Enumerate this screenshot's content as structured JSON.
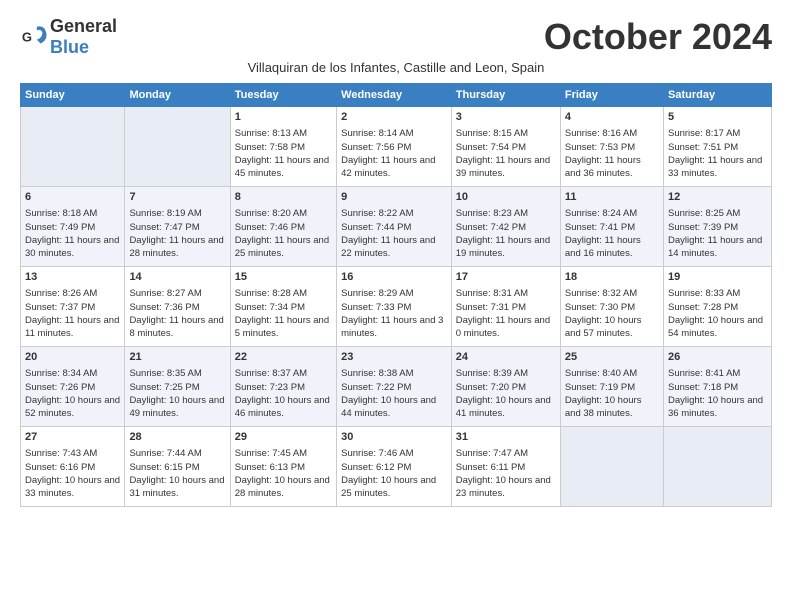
{
  "logo": {
    "text_general": "General",
    "text_blue": "Blue"
  },
  "header": {
    "month_title": "October 2024",
    "subtitle": "Villaquiran de los Infantes, Castille and Leon, Spain"
  },
  "days_of_week": [
    "Sunday",
    "Monday",
    "Tuesday",
    "Wednesday",
    "Thursday",
    "Friday",
    "Saturday"
  ],
  "weeks": [
    [
      {
        "day": "",
        "info": ""
      },
      {
        "day": "",
        "info": ""
      },
      {
        "day": "1",
        "info": "Sunrise: 8:13 AM\nSunset: 7:58 PM\nDaylight: 11 hours and 45 minutes."
      },
      {
        "day": "2",
        "info": "Sunrise: 8:14 AM\nSunset: 7:56 PM\nDaylight: 11 hours and 42 minutes."
      },
      {
        "day": "3",
        "info": "Sunrise: 8:15 AM\nSunset: 7:54 PM\nDaylight: 11 hours and 39 minutes."
      },
      {
        "day": "4",
        "info": "Sunrise: 8:16 AM\nSunset: 7:53 PM\nDaylight: 11 hours and 36 minutes."
      },
      {
        "day": "5",
        "info": "Sunrise: 8:17 AM\nSunset: 7:51 PM\nDaylight: 11 hours and 33 minutes."
      }
    ],
    [
      {
        "day": "6",
        "info": "Sunrise: 8:18 AM\nSunset: 7:49 PM\nDaylight: 11 hours and 30 minutes."
      },
      {
        "day": "7",
        "info": "Sunrise: 8:19 AM\nSunset: 7:47 PM\nDaylight: 11 hours and 28 minutes."
      },
      {
        "day": "8",
        "info": "Sunrise: 8:20 AM\nSunset: 7:46 PM\nDaylight: 11 hours and 25 minutes."
      },
      {
        "day": "9",
        "info": "Sunrise: 8:22 AM\nSunset: 7:44 PM\nDaylight: 11 hours and 22 minutes."
      },
      {
        "day": "10",
        "info": "Sunrise: 8:23 AM\nSunset: 7:42 PM\nDaylight: 11 hours and 19 minutes."
      },
      {
        "day": "11",
        "info": "Sunrise: 8:24 AM\nSunset: 7:41 PM\nDaylight: 11 hours and 16 minutes."
      },
      {
        "day": "12",
        "info": "Sunrise: 8:25 AM\nSunset: 7:39 PM\nDaylight: 11 hours and 14 minutes."
      }
    ],
    [
      {
        "day": "13",
        "info": "Sunrise: 8:26 AM\nSunset: 7:37 PM\nDaylight: 11 hours and 11 minutes."
      },
      {
        "day": "14",
        "info": "Sunrise: 8:27 AM\nSunset: 7:36 PM\nDaylight: 11 hours and 8 minutes."
      },
      {
        "day": "15",
        "info": "Sunrise: 8:28 AM\nSunset: 7:34 PM\nDaylight: 11 hours and 5 minutes."
      },
      {
        "day": "16",
        "info": "Sunrise: 8:29 AM\nSunset: 7:33 PM\nDaylight: 11 hours and 3 minutes."
      },
      {
        "day": "17",
        "info": "Sunrise: 8:31 AM\nSunset: 7:31 PM\nDaylight: 11 hours and 0 minutes."
      },
      {
        "day": "18",
        "info": "Sunrise: 8:32 AM\nSunset: 7:30 PM\nDaylight: 10 hours and 57 minutes."
      },
      {
        "day": "19",
        "info": "Sunrise: 8:33 AM\nSunset: 7:28 PM\nDaylight: 10 hours and 54 minutes."
      }
    ],
    [
      {
        "day": "20",
        "info": "Sunrise: 8:34 AM\nSunset: 7:26 PM\nDaylight: 10 hours and 52 minutes."
      },
      {
        "day": "21",
        "info": "Sunrise: 8:35 AM\nSunset: 7:25 PM\nDaylight: 10 hours and 49 minutes."
      },
      {
        "day": "22",
        "info": "Sunrise: 8:37 AM\nSunset: 7:23 PM\nDaylight: 10 hours and 46 minutes."
      },
      {
        "day": "23",
        "info": "Sunrise: 8:38 AM\nSunset: 7:22 PM\nDaylight: 10 hours and 44 minutes."
      },
      {
        "day": "24",
        "info": "Sunrise: 8:39 AM\nSunset: 7:20 PM\nDaylight: 10 hours and 41 minutes."
      },
      {
        "day": "25",
        "info": "Sunrise: 8:40 AM\nSunset: 7:19 PM\nDaylight: 10 hours and 38 minutes."
      },
      {
        "day": "26",
        "info": "Sunrise: 8:41 AM\nSunset: 7:18 PM\nDaylight: 10 hours and 36 minutes."
      }
    ],
    [
      {
        "day": "27",
        "info": "Sunrise: 7:43 AM\nSunset: 6:16 PM\nDaylight: 10 hours and 33 minutes."
      },
      {
        "day": "28",
        "info": "Sunrise: 7:44 AM\nSunset: 6:15 PM\nDaylight: 10 hours and 31 minutes."
      },
      {
        "day": "29",
        "info": "Sunrise: 7:45 AM\nSunset: 6:13 PM\nDaylight: 10 hours and 28 minutes."
      },
      {
        "day": "30",
        "info": "Sunrise: 7:46 AM\nSunset: 6:12 PM\nDaylight: 10 hours and 25 minutes."
      },
      {
        "day": "31",
        "info": "Sunrise: 7:47 AM\nSunset: 6:11 PM\nDaylight: 10 hours and 23 minutes."
      },
      {
        "day": "",
        "info": ""
      },
      {
        "day": "",
        "info": ""
      }
    ]
  ]
}
